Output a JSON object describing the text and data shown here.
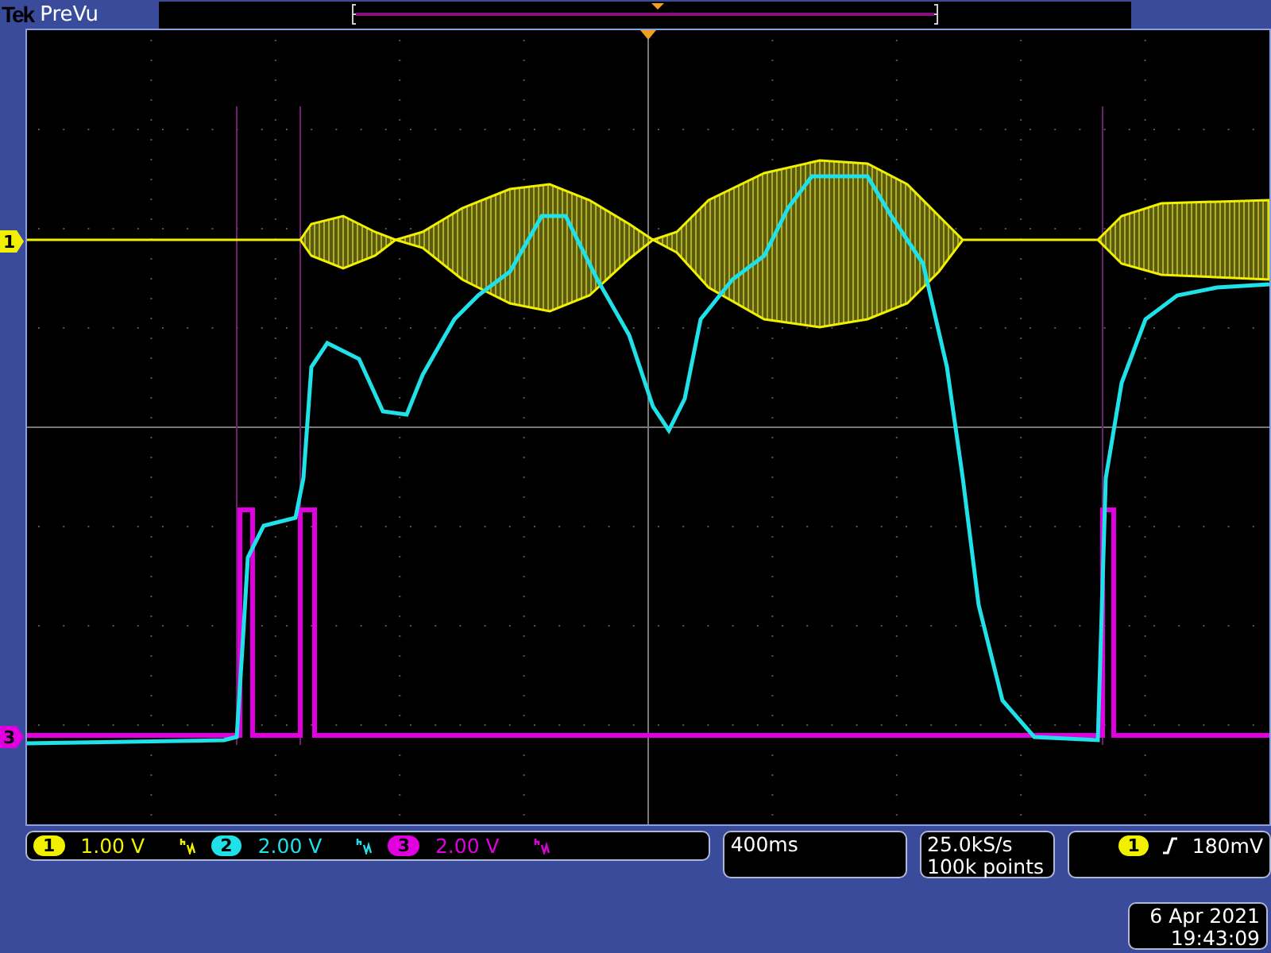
{
  "brand": {
    "logo": "Tek",
    "mode": "PreVu"
  },
  "channel_markers": [
    {
      "label": "1",
      "color": "#f0f000"
    },
    {
      "label": "3",
      "color": "#e000e0"
    }
  ],
  "channels": [
    {
      "label": "1",
      "scale": "1.00 V",
      "color": "#f0f000",
      "bandwidth_limited": true
    },
    {
      "label": "2",
      "scale": "2.00 V",
      "color": "#20e0e8",
      "bandwidth_limited": true
    },
    {
      "label": "3",
      "scale": "2.00 V",
      "color": "#e000e0",
      "bandwidth_limited": true
    }
  ],
  "timebase": "400ms",
  "acquisition": {
    "rate": "25.0kS/s",
    "record": "100k points"
  },
  "trigger": {
    "source": "1",
    "level": "180mV",
    "color": "#f0f000"
  },
  "datetime": {
    "date": "6 Apr 2021",
    "time": "19:43:09"
  }
}
